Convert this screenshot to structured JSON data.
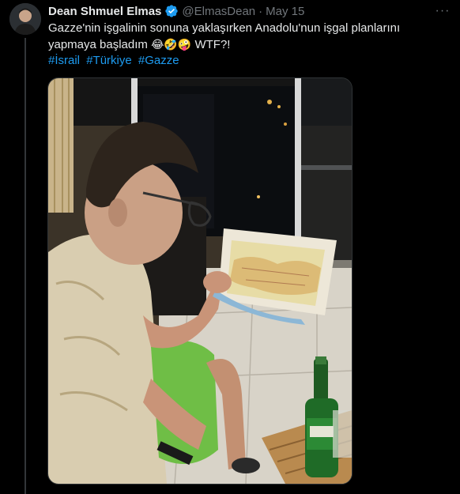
{
  "tweet": {
    "author_name": "Dean Shmuel Elmas",
    "handle": "@ElmasDean",
    "separator": "·",
    "date": "May 15",
    "text_line1": "Gazze'nin işgalinin sonuna yaklaşırken Anadolu'nun işgal planlarını",
    "text_line2": "yapmaya başladım",
    "emojis": "😂🤣🤪",
    "text_end": "WTF?!",
    "hashtags": [
      "#İsrail",
      "#Türkiye",
      "#Gazze"
    ],
    "more_label": "···"
  },
  "icons": {
    "verified": "verified-badge-icon",
    "more": "more-options-icon"
  },
  "colors": {
    "background": "#000000",
    "text": "#e7e9ea",
    "muted": "#71767b",
    "link": "#1d9bf0",
    "verified": "#1d9bf0"
  }
}
